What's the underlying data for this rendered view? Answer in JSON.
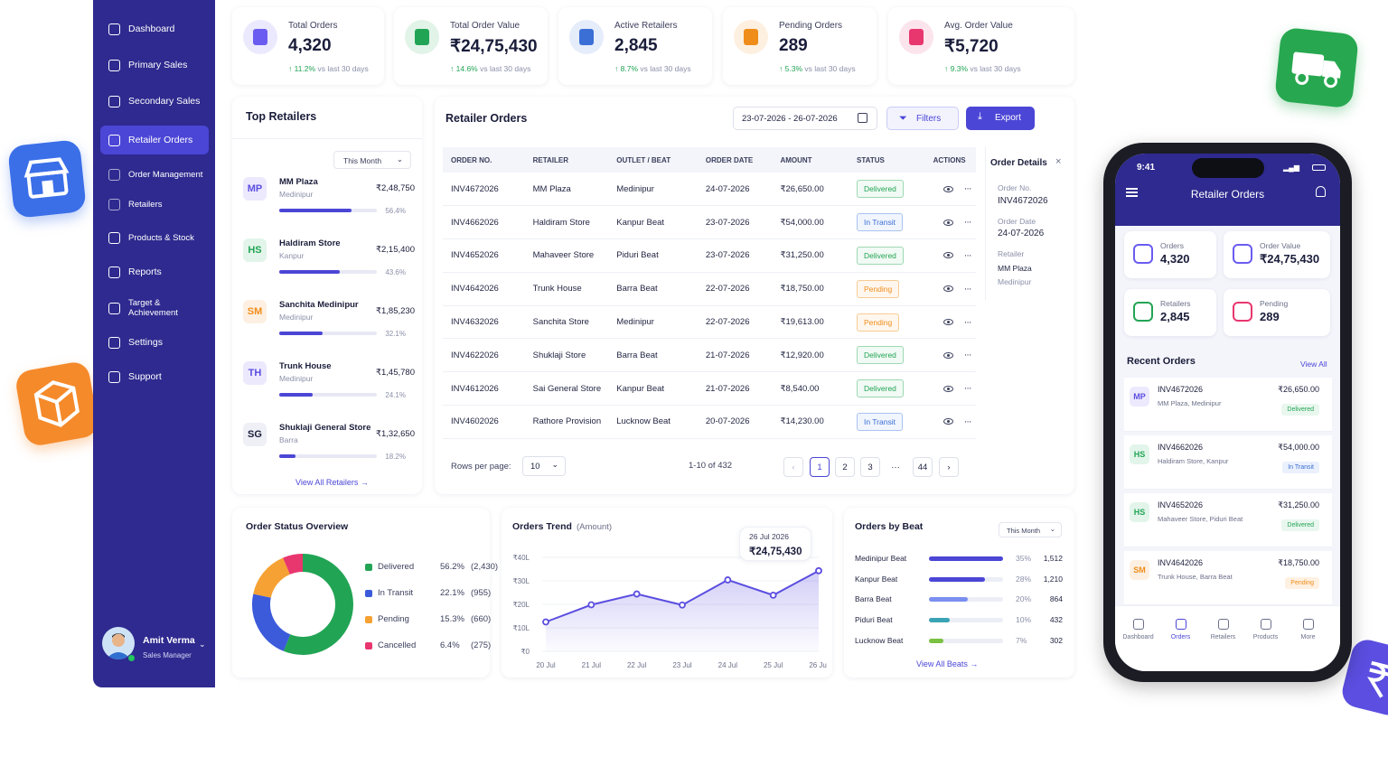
{
  "sidebar": {
    "items": [
      {
        "label": "Dashboard",
        "icon": "home-icon"
      },
      {
        "label": "Primary Sales",
        "icon": "cart-icon"
      },
      {
        "label": "Secondary Sales",
        "icon": "cart-icon"
      },
      {
        "label": "Retailer Orders",
        "icon": "cart-icon",
        "active": true
      },
      {
        "label": "Order Management",
        "icon": "cart-icon"
      },
      {
        "label": "Retailers",
        "icon": "store-icon"
      },
      {
        "label": "Products & Stock",
        "icon": "box-icon"
      },
      {
        "label": "Reports",
        "icon": "bar-chart-icon"
      },
      {
        "label": "Target & Achievement",
        "icon": "target-icon"
      },
      {
        "label": "Settings",
        "icon": "gear-icon"
      },
      {
        "label": "Support",
        "icon": "help-icon"
      }
    ],
    "user": {
      "name": "Amit Verma",
      "role": "Sales Manager"
    }
  },
  "kpis": [
    {
      "label": "Total Orders",
      "value": "4,320",
      "change": "11.2%",
      "suffix": "vs last 30 days",
      "color": "#6a5cf0"
    },
    {
      "label": "Total Order Value",
      "value": "₹24,75,430",
      "change": "14.6%",
      "suffix": "vs last 30 days",
      "color": "#22a455"
    },
    {
      "label": "Active Retailers",
      "value": "2,845",
      "change": "8.7%",
      "suffix": "vs last 30 days",
      "color": "#3b6fd6"
    },
    {
      "label": "Pending Orders",
      "value": "289",
      "change": "5.3%",
      "suffix": "vs last 30 days",
      "color": "#f08c1a"
    },
    {
      "label": "Avg. Order Value",
      "value": "₹5,720",
      "change": "9.3%",
      "suffix": "vs last 30 days",
      "color": "#e8366e"
    }
  ],
  "top_retailers": {
    "title": "Top Retailers",
    "filter": "This Month",
    "items": [
      {
        "initials": "MP",
        "name": "MM Plaza",
        "location": "Medinipur",
        "amount": "₹2,48,750",
        "pct": "56.4%",
        "fill": 0.74,
        "bg": "#ece9fd",
        "fg": "#5b4ee0"
      },
      {
        "initials": "HS",
        "name": "Haldiram Store",
        "location": "Kanpur",
        "amount": "₹2,15,400",
        "pct": "43.6%",
        "fill": 0.62,
        "bg": "#e3f5ea",
        "fg": "#22a455"
      },
      {
        "initials": "SM",
        "name": "Sanchita Medinipur",
        "location": "Medinipur",
        "amount": "₹1,85,230",
        "pct": "32.1%",
        "fill": 0.44,
        "bg": "#fdf0e2",
        "fg": "#f08c1a"
      },
      {
        "initials": "TH",
        "name": "Trunk House",
        "location": "Medinipur",
        "amount": "₹1,45,780",
        "pct": "24.1%",
        "fill": 0.34,
        "bg": "#ece9fd",
        "fg": "#5b4ee0"
      },
      {
        "initials": "SG",
        "name": "Shuklaji General Store",
        "location": "Barra",
        "amount": "₹1,32,650",
        "pct": "18.2%",
        "fill": 0.17,
        "bg": "#eef0f6",
        "fg": "#1a1d3a"
      }
    ],
    "view_all": "View All Retailers →"
  },
  "orders": {
    "title": "Retailer Orders",
    "date_range": "23-07-2026 - 26-07-2026",
    "filters_label": "Filters",
    "export_label": "Export",
    "columns": [
      "ORDER NO.",
      "RETAILER",
      "OUTLET / BEAT",
      "ORDER DATE",
      "AMOUNT",
      "STATUS",
      "ACTIONS"
    ],
    "rows": [
      {
        "no": "INV4672026",
        "retailer": "MM Plaza",
        "outlet": "Medinipur",
        "date": "24-07-2026",
        "amount": "₹26,650.00",
        "status": "Delivered"
      },
      {
        "no": "INV4662026",
        "retailer": "Haldiram Store",
        "outlet": "Kanpur Beat",
        "date": "23-07-2026",
        "amount": "₹54,000.00",
        "status": "In Transit"
      },
      {
        "no": "INV4652026",
        "retailer": "Mahaveer Store",
        "outlet": "Piduri Beat",
        "date": "23-07-2026",
        "amount": "₹31,250.00",
        "status": "Delivered"
      },
      {
        "no": "INV4642026",
        "retailer": "Trunk House",
        "outlet": "Barra Beat",
        "date": "22-07-2026",
        "amount": "₹18,750.00",
        "status": "Pending"
      },
      {
        "no": "INV4632026",
        "retailer": "Sanchita Store",
        "outlet": "Medinipur",
        "date": "22-07-2026",
        "amount": "₹19,613.00",
        "status": "Pending"
      },
      {
        "no": "INV4622026",
        "retailer": "Shuklaji Store",
        "outlet": "Barra Beat",
        "date": "21-07-2026",
        "amount": "₹12,920.00",
        "status": "Delivered"
      },
      {
        "no": "INV4612026",
        "retailer": "Sai General Store",
        "outlet": "Kanpur Beat",
        "date": "21-07-2026",
        "amount": "₹8,540.00",
        "status": "Delivered"
      },
      {
        "no": "INV4602026",
        "retailer": "Rathore Provision",
        "outlet": "Lucknow Beat",
        "date": "20-07-2026",
        "amount": "₹14,230.00",
        "status": "In Transit"
      }
    ],
    "rows_per_page_label": "Rows per page:",
    "rows_per_page": "10",
    "range_text": "1-10 of 432",
    "pages": [
      "1",
      "2",
      "3",
      "···",
      "44"
    ]
  },
  "order_details": {
    "title": "Order Details",
    "order_no_label": "Order No.",
    "order_no": "INV4672026",
    "order_date_label": "Order Date",
    "order_date": "24-07-2026",
    "retailer_label": "Retailer",
    "retailer": "MM Plaza",
    "location": "Medinipur"
  },
  "status_overview": {
    "title": "Order Status Overview",
    "items": [
      {
        "label": "Delivered",
        "pct": "56.2%",
        "count": "(2,430)",
        "value": 56.2,
        "color": "#22a455"
      },
      {
        "label": "In Transit",
        "pct": "22.1%",
        "count": "(955)",
        "value": 22.1,
        "color": "#3b5bdb"
      },
      {
        "label": "Pending",
        "pct": "15.3%",
        "count": "(660)",
        "value": 15.3,
        "color": "#f5a133"
      },
      {
        "label": "Cancelled",
        "pct": "6.4%",
        "count": "(275)",
        "value": 6.4,
        "color": "#e8366e"
      }
    ]
  },
  "chart_data": {
    "type": "area",
    "title": "Orders Trend",
    "subtitle": "(Amount)",
    "categories": [
      "20 Jul",
      "21 Jul",
      "22 Jul",
      "23 Jul",
      "24 Jul",
      "25 Jul",
      "26 Jul"
    ],
    "x": [
      "20 Jul",
      "20.5",
      "21 Jul",
      "22 Jul",
      "23 Jul",
      "24 Jul",
      "25 Jul",
      "26 Jul"
    ],
    "values": [
      12.5,
      19.8,
      24.4,
      19.7,
      30.4,
      23.9,
      34.3
    ],
    "y_unit": "₹L",
    "yticks": [
      "₹40L",
      "₹30L",
      "₹20L",
      "₹10L",
      "₹0"
    ],
    "ylim": [
      0,
      40
    ],
    "grid": true,
    "tooltip": {
      "date": "26 Jul 2026",
      "value": "₹24,75,430"
    }
  },
  "beats": {
    "title": "Orders by Beat",
    "filter": "This Month",
    "items": [
      {
        "name": "Medinipur Beat",
        "pct": "35%",
        "count": "1,512",
        "fill": 1.0,
        "color": "#4b46d6"
      },
      {
        "name": "Kanpur Beat",
        "pct": "28%",
        "count": "1,210",
        "fill": 0.76,
        "color": "#4b46d6"
      },
      {
        "name": "Barra Beat",
        "pct": "20%",
        "count": "864",
        "fill": 0.53,
        "color": "#7a8ff0"
      },
      {
        "name": "Piduri Beat",
        "pct": "10%",
        "count": "432",
        "fill": 0.28,
        "color": "#3aa3b5"
      },
      {
        "name": "Lucknow Beat",
        "pct": "7%",
        "count": "302",
        "fill": 0.19,
        "color": "#7bc142"
      }
    ],
    "view_all": "View All Beats →"
  },
  "phone": {
    "time": "9:41",
    "title": "Retailer Orders",
    "kpis": [
      {
        "label": "Orders",
        "value": "4,320",
        "color": "#6a5cf0"
      },
      {
        "label": "Order Value",
        "value": "₹24,75,430",
        "color": "#6a5cf0"
      },
      {
        "label": "Retailers",
        "value": "2,845",
        "color": "#22a455"
      },
      {
        "label": "Pending",
        "value": "289",
        "color": "#e8366e"
      }
    ],
    "recent_title": "Recent Orders",
    "view_all": "View All",
    "recent": [
      {
        "initials": "MP",
        "no": "INV4672026",
        "desc": "MM Plaza, Medinipur",
        "amount": "₹26,650.00",
        "status": "Delivered"
      },
      {
        "initials": "HS",
        "no": "INV4662026",
        "desc": "Haldiram Store, Kanpur",
        "amount": "₹54,000.00",
        "status": "In Transit"
      },
      {
        "initials": "HS",
        "no": "INV4652026",
        "desc": "Mahaveer Store, Piduri Beat",
        "amount": "₹31,250.00",
        "status": "Delivered"
      },
      {
        "initials": "SM",
        "no": "INV4642026",
        "desc": "Trunk House, Barra Beat",
        "amount": "₹18,750.00",
        "status": "Pending"
      }
    ],
    "nav": [
      "Dashboard",
      "Orders",
      "Retailers",
      "Products",
      "More"
    ]
  }
}
